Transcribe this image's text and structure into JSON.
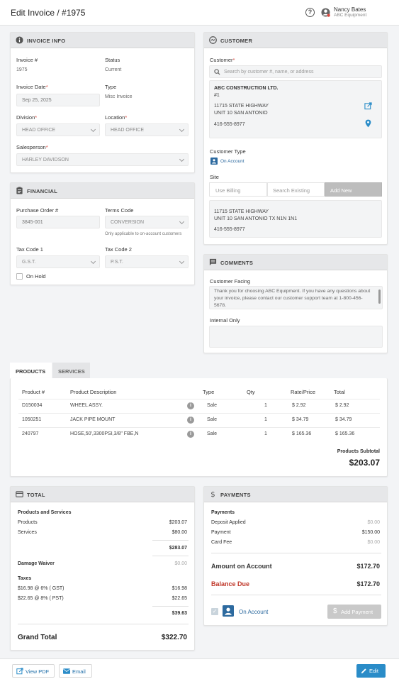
{
  "header": {
    "title": "Edit Invoice / #1975",
    "user_name": "Nancy Bates",
    "user_company": "ABC Equipment"
  },
  "invoice_info": {
    "title": "INVOICE INFO",
    "invoice_no_label": "Invoice #",
    "invoice_no": "1975",
    "status_label": "Status",
    "status": "Current",
    "date_label": "Invoice Date",
    "date": "Sep 25, 2025",
    "type_label": "Type",
    "type": "Misc Invoice",
    "division_label": "Division",
    "division": "HEAD OFFICE",
    "location_label": "Location",
    "location": "HEAD OFFICE",
    "salesperson_label": "Salesperson",
    "salesperson": "HARLEY DAVIDSON"
  },
  "financial": {
    "title": "FINANCIAL",
    "po_label": "Purchase Order #",
    "po": "3845-001",
    "terms_label": "Terms Code",
    "terms": "CONVERSION",
    "terms_note": "Only applicable to on-account customers",
    "tax1_label": "Tax Code 1",
    "tax1": "G.S.T.",
    "tax2_label": "Tax Code 2",
    "tax2": "P.S.T.",
    "on_hold_label": "On Hold"
  },
  "customer": {
    "title": "CUSTOMER",
    "customer_label": "Customer",
    "search_placeholder": "Search by customer #, name, or address",
    "name": "ABC CONSTRUCTION LTD.",
    "number": "#1",
    "address1": "11715 STATE HIGHWAY",
    "address2": "UNIT 10 SAN ANTONIO",
    "phone": "416-555-8977",
    "type_label": "Customer Type",
    "type": "On Account",
    "site_label": "Site",
    "site_tabs": [
      "Use Billing",
      "Search Existing",
      "Add New"
    ],
    "site_address1": "11715 STATE HIGHWAY",
    "site_address2": "UNIT 10 SAN ANTONIO TX N1N 1N1",
    "site_phone": "416-555-8977"
  },
  "comments": {
    "title": "COMMENTS",
    "customer_facing_label": "Customer Facing",
    "customer_facing_text": "Thank you for choosing ABC Equipment. If you have any questions about your invoice, please contact our customer support team at 1-800-456-5678.",
    "internal_label": "Internal Only"
  },
  "items": {
    "tabs": [
      "PRODUCTS",
      "SERVICES"
    ],
    "columns": [
      "Product #",
      "Product Description",
      "Type",
      "Qty",
      "Rate/Price",
      "Total"
    ],
    "rows": [
      [
        "D150034",
        "WHEEL ASSY.",
        "Sale",
        "1",
        "$ 2.92",
        "$ 2.92"
      ],
      [
        "1050251",
        "JACK PIPE MOUNT",
        "Sale",
        "1",
        "$ 34.79",
        "$ 34.79"
      ],
      [
        "240797",
        "HOSE,50',3300PSI,3/8\" FBE,N",
        "Sale",
        "1",
        "$ 165.36",
        "$ 165.36"
      ]
    ],
    "subtotal_label": "Products Subtotal",
    "subtotal": "$203.07"
  },
  "total": {
    "title": "TOTAL",
    "ps_label": "Products and Services",
    "products_label": "Products",
    "products": "$203.07",
    "services_label": "Services",
    "services": "$80.00",
    "ps_total": "$283.07",
    "damage_label": "Damage Waiver",
    "damage": "$0.00",
    "taxes_label": "Taxes",
    "tax1_label": "$16.98 @ 6% ( GST)",
    "tax1": "$16.98",
    "tax2_label": "$22.65 @ 8% ( PST)",
    "tax2": "$22.65",
    "tax_total": "$39.63",
    "grand_label": "Grand Total",
    "grand": "$322.70"
  },
  "payments": {
    "title": "PAYMENTS",
    "label": "Payments",
    "deposit_label": "Deposit Applied",
    "deposit": "$0.00",
    "payment_label": "Payment",
    "payment": "$150.00",
    "card_fee_label": "Card Fee",
    "card_fee": "$0.00",
    "amount_label": "Amount on Account",
    "amount": "$172.70",
    "balance_label": "Balance Due",
    "balance": "$172.70",
    "on_account_label": "On Account",
    "add_payment": "Add Payment"
  },
  "footer": {
    "view_pdf": "View PDF",
    "email": "Email",
    "edit": "Edit"
  },
  "colors": {
    "accent": "#2a8cc8",
    "balance_due": "#c0392b"
  }
}
